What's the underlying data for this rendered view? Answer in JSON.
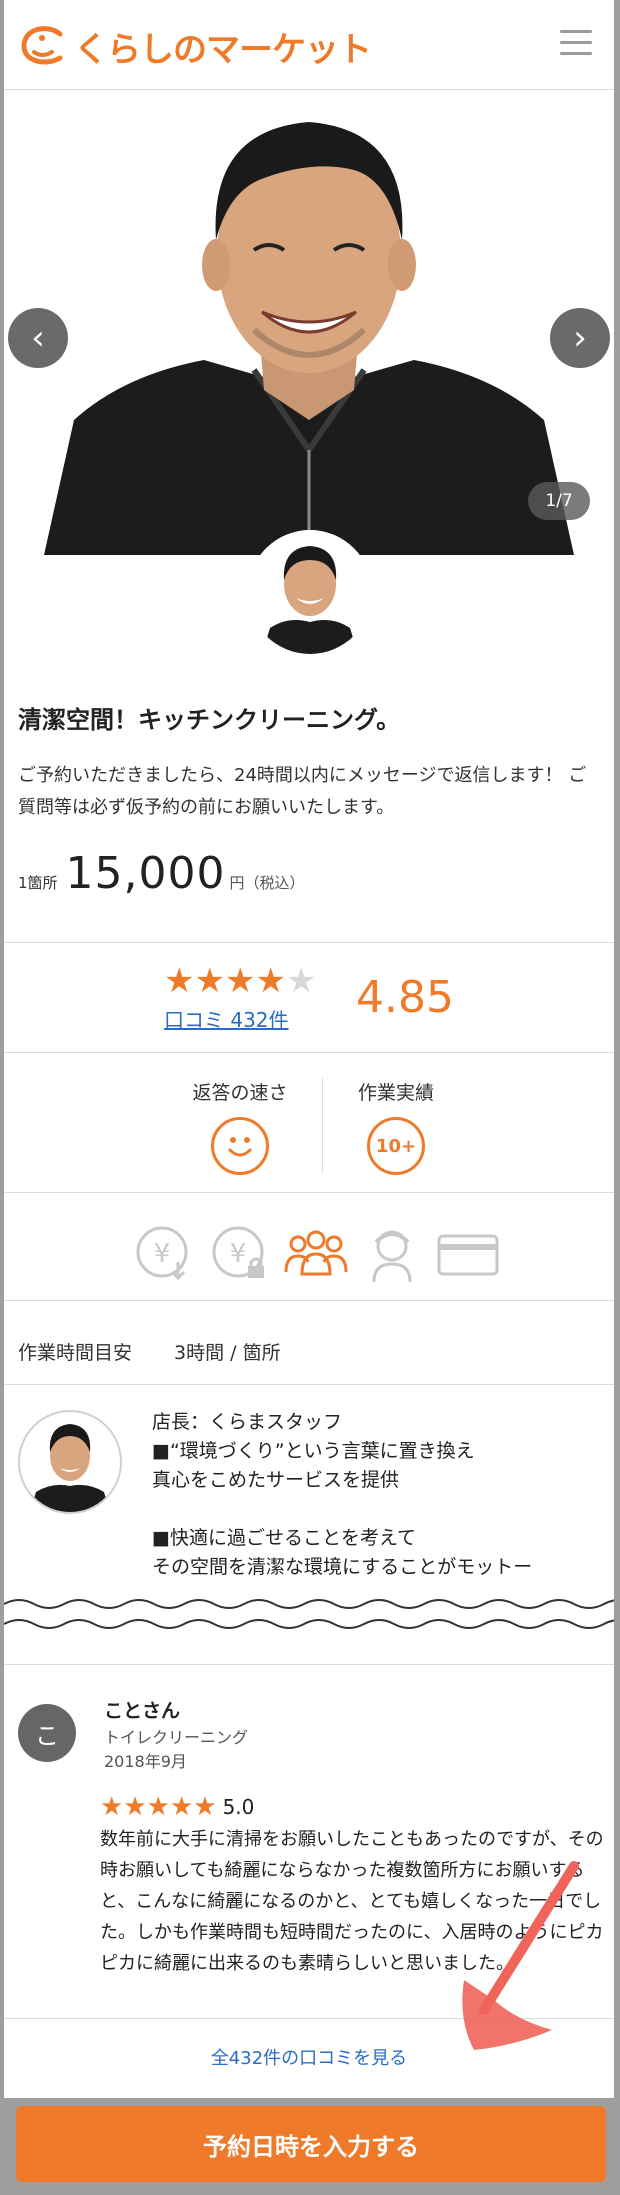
{
  "header": {
    "logo_text": "くらしのマーケット",
    "menu_icon": "hamburger-icon"
  },
  "gallery": {
    "counter": "1/7",
    "prev_icon": "chevron-left-icon",
    "next_icon": "chevron-right-icon"
  },
  "listing": {
    "title": "清潔空間！キッチンクリーニング。",
    "description": "ご予約いただきましたら、24時間以内にメッセージで返信します！ ご質問等は必ず仮予約の前にお願いいたします。",
    "price_unit": "1箇所",
    "price": "15,000",
    "price_suffix": "円（税込）"
  },
  "rating": {
    "value": "4.85",
    "stars_filled": 4,
    "stars_total": 5,
    "review_link": "口コミ 432件"
  },
  "metrics": {
    "response_label": "返答の速さ",
    "response_icon": "smile-face-icon",
    "record_label": "作業実績",
    "record_badge": "10+"
  },
  "features": [
    {
      "icon": "yen-download-icon",
      "active": false
    },
    {
      "icon": "yen-lock-icon",
      "active": false
    },
    {
      "icon": "people-group-icon",
      "active": true
    },
    {
      "icon": "female-staff-icon",
      "active": false
    },
    {
      "icon": "credit-card-icon",
      "active": false
    }
  ],
  "work_time": {
    "label": "作業時間目安",
    "value": "3時間 / 箇所"
  },
  "staff": {
    "lines": [
      "店長：くらまスタッフ",
      "■“環境づくり”という言葉に置き換え",
      "真心をこめたサービスを提供",
      "",
      "■快適に過ごせることを考えて",
      "その空間を清潔な環境にすることがモットー"
    ]
  },
  "review": {
    "avatar_initial": "こ",
    "name": "ことさん",
    "service": "トイレクリーニング",
    "date": "2018年9月",
    "score": "5.0",
    "body": "数年前に大手に清掃をお願いしたこともあったのですが、その時お願いしても綺麗にならなかった複数箇所方にお願いすると、こんなに綺麗になるのかと、とても嬉しくなった一日でした。しかも作業時間も短時間だったのに、入居時のようにピカピカに綺麗に出来るのも素晴らしいと思いました。"
  },
  "all_reviews_link": "全432件の口コミを見る",
  "cta_label": "予約日時を入力する",
  "colors": {
    "accent": "#ef7a2a",
    "link": "#2a6cc5"
  }
}
